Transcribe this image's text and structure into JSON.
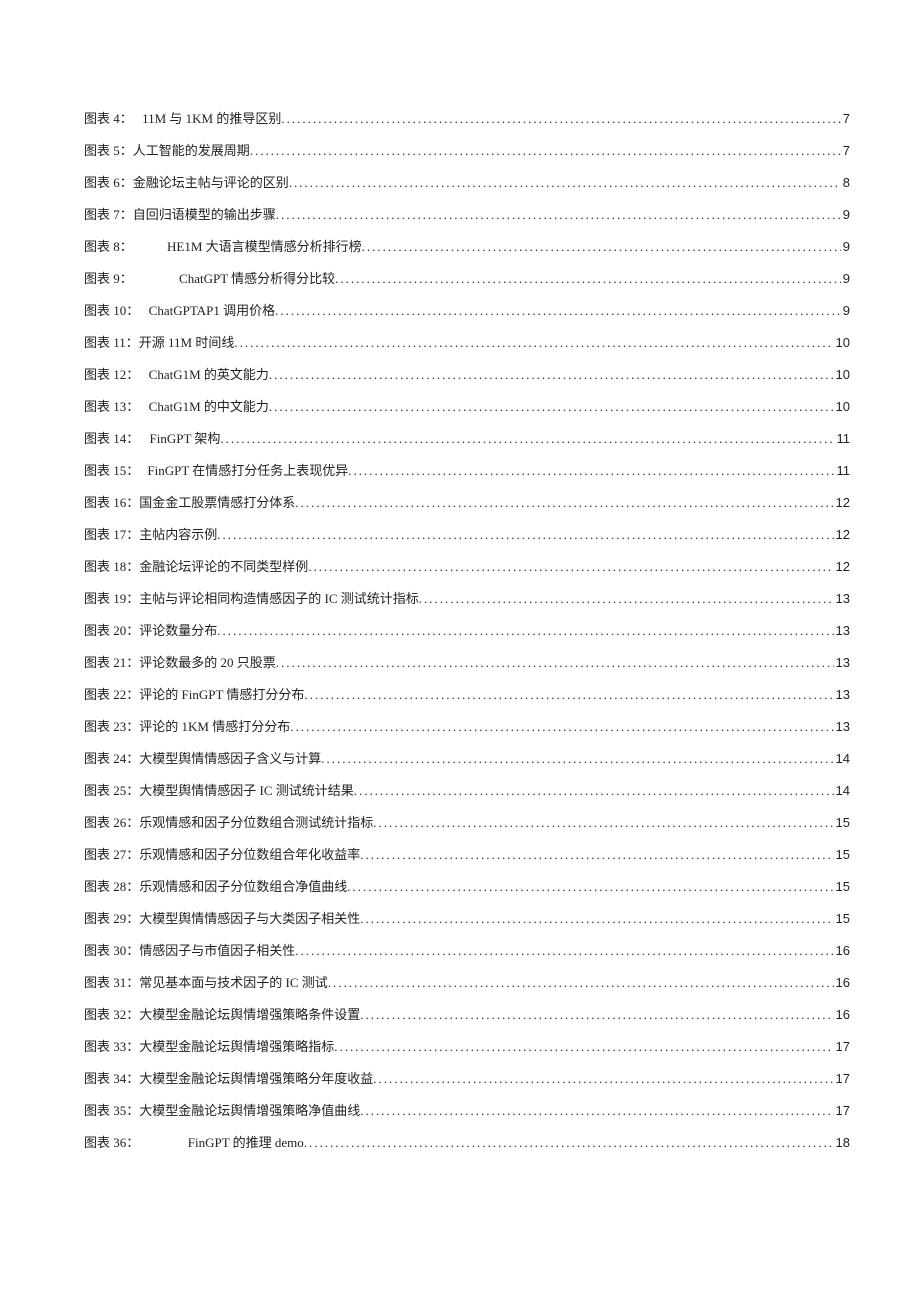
{
  "toc": [
    {
      "label": "图表 4：",
      "spacer": "sp1",
      "title": "11M 与 1KM 的推导区别",
      "page": "7"
    },
    {
      "label": "图表 5：",
      "spacer": "",
      "title": "人工智能的发展周期",
      "page": "7"
    },
    {
      "label": "图表 6：",
      "spacer": "",
      "title": "金融论坛主帖与评论的区别",
      "page": "8"
    },
    {
      "label": "图表 7：",
      "spacer": "",
      "title": "自回归语模型的输出步骤",
      "page": "9"
    },
    {
      "label": "图表 8：",
      "spacer": "sp3",
      "title": "HE1M 大语言模型情感分析排行榜",
      "page": "9"
    },
    {
      "label": "图表 9：",
      "spacer": "sp4",
      "title": "ChatGPT 情感分析得分比较",
      "page": "9"
    },
    {
      "label": "图表 10：",
      "spacer": "sp1",
      "title": "ChatGPTAP1 调用价格",
      "page": "9"
    },
    {
      "label": "图表 11：",
      "spacer": "",
      "title": "开源 11M 时间线",
      "page": "10"
    },
    {
      "label": "图表 12：",
      "spacer": "sp1",
      "title": "ChatG1M 的英文能力",
      "page": "10"
    },
    {
      "label": "图表 13：",
      "spacer": "sp1",
      "title": "ChatG1M 的中文能力",
      "page": "10"
    },
    {
      "label": "图表 14：",
      "spacer": "sp1",
      "title": "FinGPT 架构",
      "page": "11"
    },
    {
      "label": "图表 15：",
      "spacer": "sp1",
      "title": "FinGPT 在情感打分任务上表现优异",
      "page": "11"
    },
    {
      "label": "图表 16：",
      "spacer": "",
      "title": "国金金工股票情感打分体系",
      "page": "12"
    },
    {
      "label": "图表 17：",
      "spacer": "",
      "title": "主帖内容示例",
      "page": "12"
    },
    {
      "label": "图表 18：",
      "spacer": "",
      "title": "金融论坛评论的不同类型样例",
      "page": "12"
    },
    {
      "label": "图表 19：",
      "spacer": "",
      "title": "主帖与评论相同构造情感因子的 IC 测试统计指标",
      "page": "13"
    },
    {
      "label": "图表 20：",
      "spacer": "",
      "title": "评论数量分布",
      "page": "13"
    },
    {
      "label": "图表 21：",
      "spacer": "",
      "title": "评论数最多的 20 只股票",
      "page": "13"
    },
    {
      "label": "图表 22：",
      "spacer": "",
      "title": "评论的 FinGPT 情感打分分布",
      "page": "13"
    },
    {
      "label": "图表 23：",
      "spacer": "",
      "title": "评论的 1KM 情感打分分布",
      "page": "13"
    },
    {
      "label": "图表 24：",
      "spacer": "",
      "title": "大模型舆情情感因子含义与计算",
      "page": "14"
    },
    {
      "label": "图表 25：",
      "spacer": "",
      "title": "大模型舆情情感因子 IC 测试统计结果",
      "page": "14"
    },
    {
      "label": "图表 26：",
      "spacer": "",
      "title": "乐观情感和因子分位数组合测试统计指标",
      "page": "15"
    },
    {
      "label": "图表 27：",
      "spacer": "",
      "title": "乐观情感和因子分位数组合年化收益率",
      "page": "15"
    },
    {
      "label": "图表 28：",
      "spacer": "",
      "title": "乐观情感和因子分位数组合净值曲线",
      "page": "15"
    },
    {
      "label": "图表 29：",
      "spacer": "",
      "title": "大模型舆情情感因子与大类因子相关性",
      "page": "15"
    },
    {
      "label": "图表 30：",
      "spacer": "",
      "title": "情感因子与市值因子相关性",
      "page": "16"
    },
    {
      "label": "图表 31：",
      "spacer": "",
      "title": "常见基本面与技术因子的 IC 测试",
      "page": "16"
    },
    {
      "label": "图表 32：",
      "spacer": "",
      "title": "大模型金融论坛舆情增强策略条件设置",
      "page": "16"
    },
    {
      "label": "图表 33：",
      "spacer": "",
      "title": "大模型金融论坛舆情增强策略指标",
      "page": "17"
    },
    {
      "label": "图表 34：",
      "spacer": "",
      "title": "大模型金融论坛舆情增强策略分年度收益",
      "page": "17"
    },
    {
      "label": "图表 35：",
      "spacer": "",
      "title": "大模型金融论坛舆情增强策略净值曲线",
      "page": "17"
    },
    {
      "label": "图表 36：",
      "spacer": "sp4",
      "title": "FinGPT 的推理 demo",
      "page": "18"
    }
  ]
}
